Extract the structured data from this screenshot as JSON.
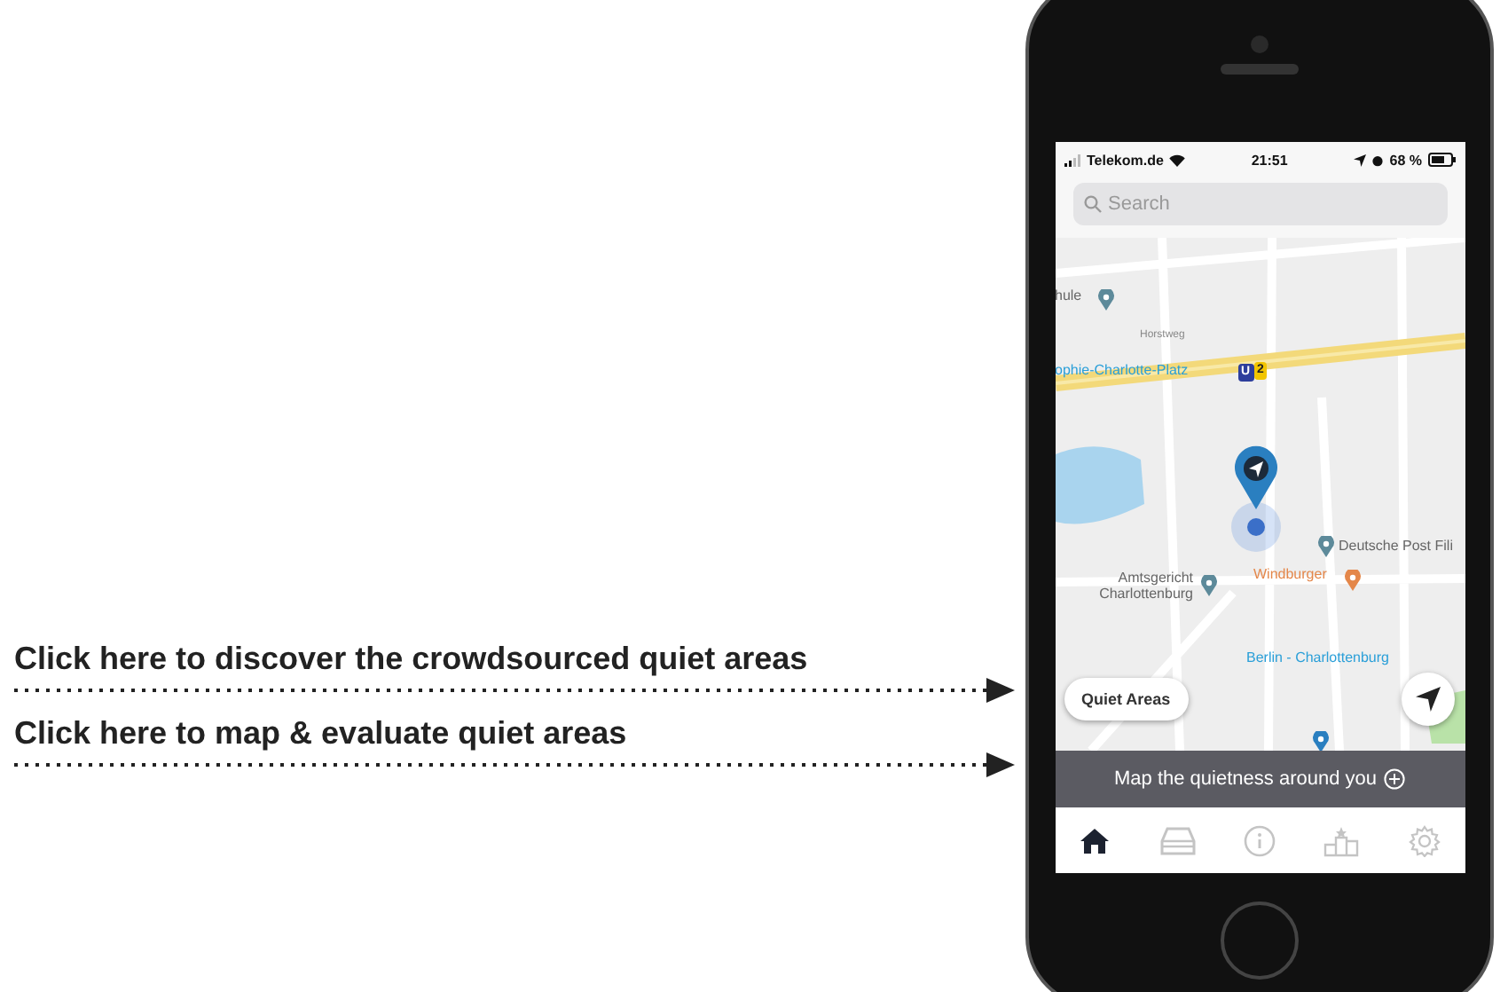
{
  "callouts": [
    {
      "text": "Click here to discover the crowdsourced quiet areas"
    },
    {
      "text": "Click here to map & evaluate quiet areas"
    }
  ],
  "status_bar": {
    "carrier": "Telekom.de",
    "time": "21:51",
    "battery": "68 %"
  },
  "search": {
    "placeholder": "Search"
  },
  "map": {
    "labels": [
      {
        "text": "hule",
        "kind": "place"
      },
      {
        "text": "Horstweg",
        "kind": "street"
      },
      {
        "text": "ophie-Charlotte-Platz",
        "kind": "transit"
      },
      {
        "text": "U",
        "kind": "subway-badge"
      },
      {
        "text": "2",
        "kind": "line-badge"
      },
      {
        "text": "Deutsche Post Fili",
        "kind": "place"
      },
      {
        "text": "Amtsgericht Charlottenburg",
        "kind": "place"
      },
      {
        "text": "Windburger",
        "kind": "food"
      },
      {
        "text": "Berlin - Charlottenburg",
        "kind": "transit"
      }
    ],
    "quiet_areas_button": "Quiet Areas"
  },
  "banner": {
    "text": "Map the quietness around you"
  },
  "tabs": [
    {
      "kind": "home",
      "selected": true
    },
    {
      "kind": "tray",
      "selected": false
    },
    {
      "kind": "info",
      "selected": false
    },
    {
      "kind": "podium",
      "selected": false
    },
    {
      "kind": "settings",
      "selected": false
    }
  ]
}
